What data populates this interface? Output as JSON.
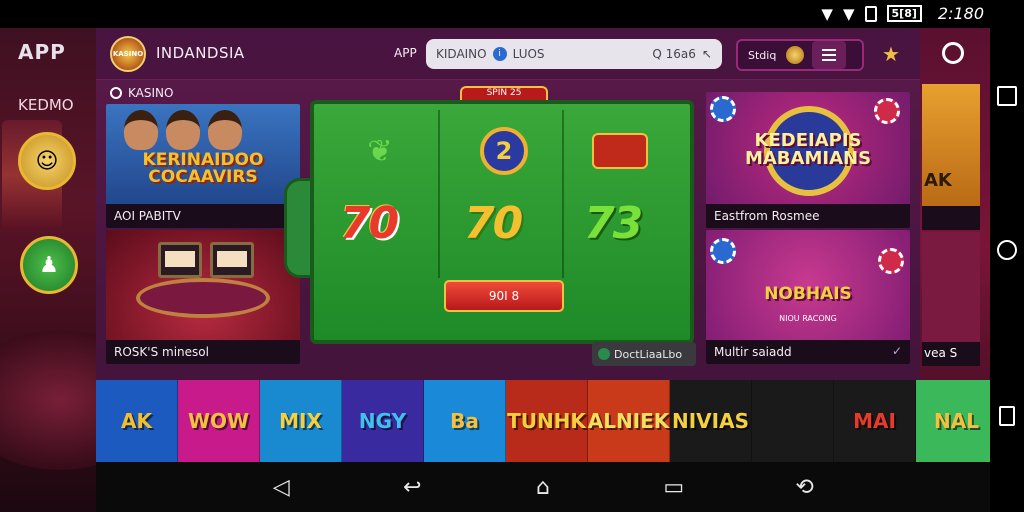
{
  "status_bar": {
    "time": "2:180",
    "badge": "5[8]"
  },
  "background": {
    "app_word": "APP",
    "kasino_word": "KEDMO"
  },
  "header": {
    "logo_text": "KASINO",
    "brand": "INDANDSIA",
    "app_label": "APP",
    "search_value": "KIDAINO",
    "search_text2": "LUOS",
    "search_text3": "Q 16a6",
    "menu_text": "Stdiq"
  },
  "section": {
    "label": "KASINO"
  },
  "cards": {
    "left1": {
      "title": "KERINAIDOO COCAAVIRS",
      "caption": "AOI PABITV"
    },
    "left2": {
      "caption": "ROSK'S minesol"
    },
    "right1": {
      "title": "KEDEIAPIS MABAMIANS",
      "caption": "Eastfrom Rosmee"
    },
    "right2": {
      "title": "NOBHAIS",
      "subtitle": "NIOU RACONG",
      "caption": "Multir saiadd"
    },
    "peek1": {
      "title": "AK"
    },
    "peek2": {
      "caption": "vea S"
    }
  },
  "slot": {
    "tab_label": "SPIN 25",
    "reels": [
      "70",
      "70",
      "73"
    ],
    "symbols": [
      "leaf-icon",
      "number-2-badge",
      "ticket-icon"
    ],
    "spin_label": "90I 8",
    "download_label": "DoctLiaaLbo"
  },
  "game_strip": [
    {
      "name": "AK",
      "bg": "#1c5ac0",
      "fg": "#f0c030"
    },
    {
      "name": "WOW",
      "bg": "#c81a8a",
      "fg": "#f4c040"
    },
    {
      "name": "MIX",
      "bg": "#1a8ad0",
      "fg": "#f4d040"
    },
    {
      "name": "NGY",
      "bg": "#3a2aa0",
      "fg": "#40c0f0"
    },
    {
      "name": "Ba",
      "bg": "#1a8ad8",
      "fg": "#f4c040"
    },
    {
      "name": "TUNHK",
      "bg": "#b82a1a",
      "fg": "#f4d040"
    },
    {
      "name": "ALNIEK",
      "bg": "#c83a1a",
      "fg": "#f4e060"
    },
    {
      "name": "NIVIAS",
      "bg": "#1a1a1a",
      "fg": "#f4d040"
    },
    {
      "name": "",
      "bg": "#1a1a1a",
      "fg": "#f4c040"
    },
    {
      "name": "MAI",
      "bg": "#1a1a1a",
      "fg": "#e83a2a"
    },
    {
      "name": "NAL",
      "bg": "#3ab85a",
      "fg": "#f4c040"
    }
  ],
  "nav": {
    "back": "◁",
    "back2": "↩",
    "home": "⌂",
    "recents": "▭",
    "rotate": "⟲"
  }
}
